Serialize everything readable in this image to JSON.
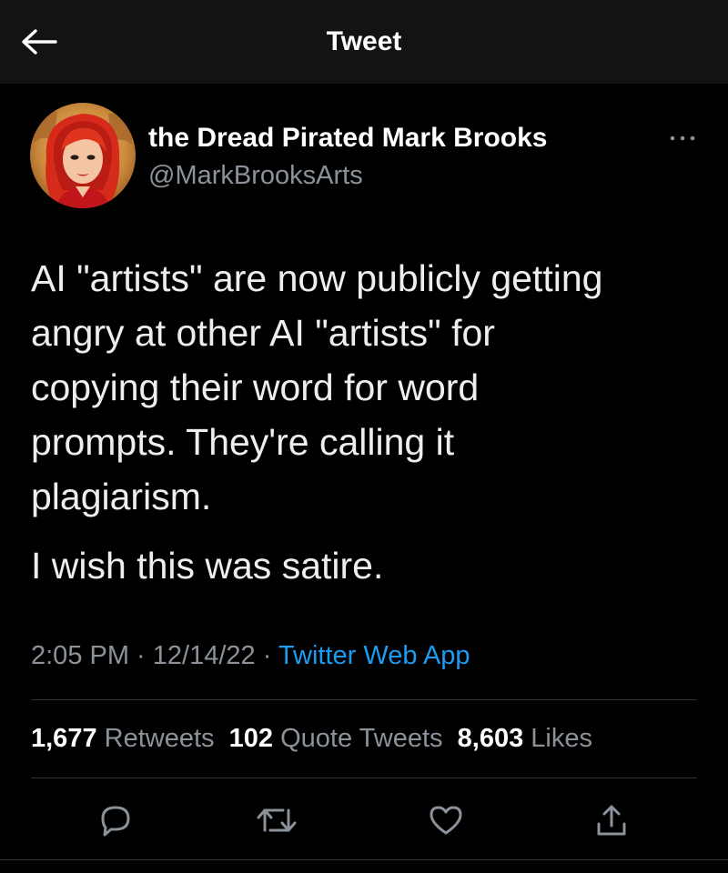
{
  "header": {
    "title": "Tweet",
    "back_icon": "arrow-left-icon"
  },
  "author": {
    "name": "the Dread Pirated Mark Brooks",
    "handle": "@MarkBrooksArts",
    "avatar": "avatar-illustration"
  },
  "tweet": {
    "text_lines": [
      "AI \"artists\" are now publicly getting",
      "angry at other AI \"artists\" for",
      "copying their word for word",
      "prompts. They're calling it",
      "plagiarism."
    ],
    "text_second": "I wish this was satire."
  },
  "meta": {
    "time": "2:05 PM",
    "sep1": " · ",
    "date": "12/14/22",
    "sep2": " · ",
    "source": "Twitter Web App"
  },
  "stats": {
    "retweets_count": "1,677",
    "retweets_label": "Retweets",
    "quotes_count": "102",
    "quotes_label": "Quote Tweets",
    "likes_count": "8,603",
    "likes_label": "Likes"
  },
  "actions": [
    "reply-icon",
    "retweet-icon",
    "like-icon",
    "share-icon"
  ],
  "colors": {
    "background": "#000000",
    "header_background": "#131313",
    "accent": "#1d9bf0",
    "secondary_text": "#8b9299",
    "divider": "#2f3336"
  }
}
